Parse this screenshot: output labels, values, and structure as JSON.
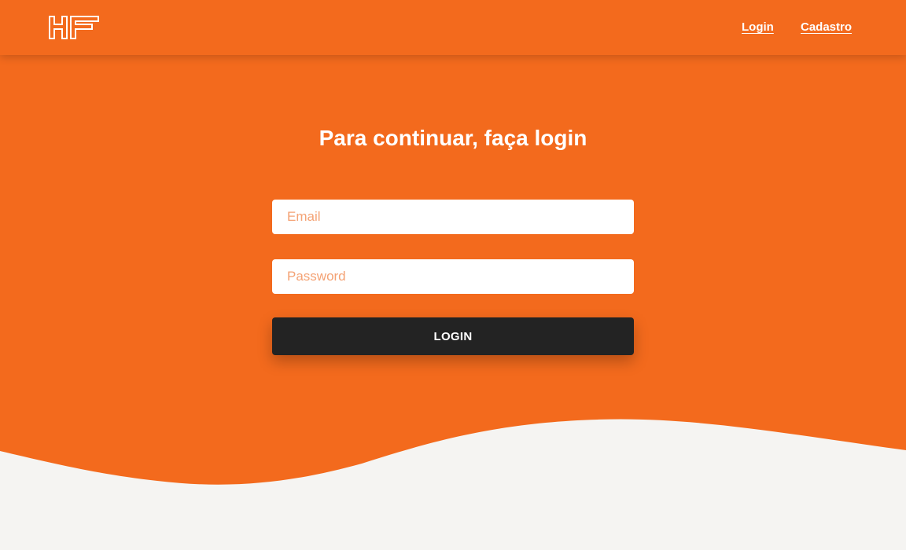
{
  "colors": {
    "brand_orange": "#f36a1d",
    "background_light": "#f5f4f2",
    "button_dark": "#232323",
    "placeholder": "#f4a274"
  },
  "header": {
    "logo_icon": "hf-logo-icon",
    "logo_text": "HF",
    "nav": {
      "login_label": "Login",
      "signup_label": "Cadastro"
    }
  },
  "main": {
    "title": "Para continuar, faça login",
    "email": {
      "value": "",
      "placeholder": "Email"
    },
    "password": {
      "value": "",
      "placeholder": "Password"
    },
    "submit_label": "LOGIN"
  }
}
